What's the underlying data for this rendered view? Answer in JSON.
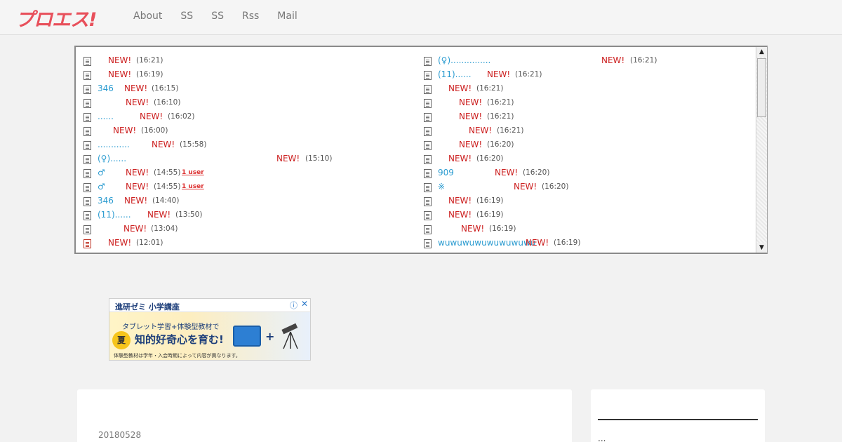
{
  "header": {
    "logo": "プロエス!",
    "nav": [
      "About",
      "SS",
      "SS",
      "Rss",
      "Mail"
    ]
  },
  "feed": {
    "new_label": "NEW!",
    "left": [
      {
        "title": "",
        "time": "(16:21)",
        "users": ""
      },
      {
        "title": "",
        "time": "(16:19)",
        "users": ""
      },
      {
        "title": "346",
        "time": "(16:15)",
        "users": ""
      },
      {
        "title": "",
        "time": "(16:10)",
        "users": ""
      },
      {
        "title": "......",
        "time": "(16:02)",
        "users": ""
      },
      {
        "title": "",
        "time": "(16:00)",
        "users": ""
      },
      {
        "title": "............",
        "time": "(15:58)",
        "users": ""
      },
      {
        "title": "(♀)......",
        "time": "(15:10)",
        "users": ""
      },
      {
        "title": "♂",
        "time": "(14:55)",
        "users": "1 user"
      },
      {
        "title": "♂",
        "time": "(14:55)",
        "users": "1 user"
      },
      {
        "title": "346",
        "time": "(14:40)",
        "users": ""
      },
      {
        "title": "(11)......",
        "time": "(13:50)",
        "users": ""
      },
      {
        "title": "",
        "time": "(13:04)",
        "users": ""
      },
      {
        "title": "",
        "time": "(12:01)",
        "users": ""
      }
    ],
    "right": [
      {
        "title": "(♀)...............",
        "time": "(16:21)"
      },
      {
        "title": "(11)......",
        "time": "(16:21)"
      },
      {
        "title": "",
        "time": "(16:21)"
      },
      {
        "title": "",
        "time": "(16:21)"
      },
      {
        "title": "",
        "time": "(16:21)"
      },
      {
        "title": "",
        "time": "(16:21)"
      },
      {
        "title": "",
        "time": "(16:20)"
      },
      {
        "title": "",
        "time": "(16:20)"
      },
      {
        "title": "909",
        "time": "(16:20)"
      },
      {
        "title": "※",
        "time": "(16:20)"
      },
      {
        "title": "",
        "time": "(16:19)"
      },
      {
        "title": "",
        "time": "(16:19)"
      },
      {
        "title": "",
        "time": "(16:19)"
      },
      {
        "title": "wuwuwuwuwuwuwuwu",
        "time": "(16:19)"
      }
    ]
  },
  "ad": {
    "title": "進研ゼミ 小学講座",
    "info_icon": "ⓘ",
    "close_icon": "✕",
    "subtitle": "タブレット学習+体験型教材で",
    "badge": "夏",
    "headline": "知的好奇心を育む!",
    "plus": "+",
    "footnote": "体験型教材は学年・入会時期によって内容が異なります。"
  },
  "main_card": {
    "date": "20180528"
  },
  "side_card": {
    "text": "..."
  },
  "colors": {
    "accent": "#e8505b",
    "link": "#2a9bd0",
    "new": "#cc1f1f"
  }
}
